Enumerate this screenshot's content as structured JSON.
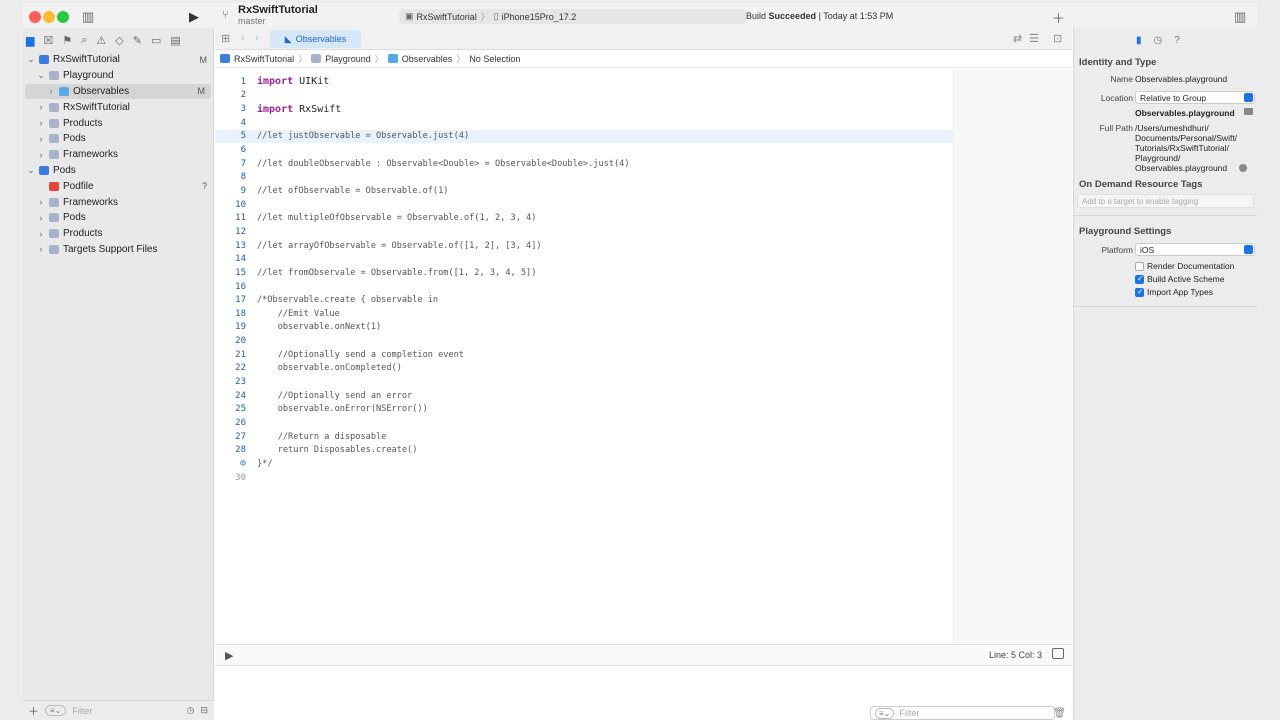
{
  "titlebar": {
    "project_name": "RxSwiftTutorial",
    "branch": "master",
    "scheme": "RxSwiftTutorial",
    "destination": "iPhone15Pro_17.2",
    "build_prefix": "Build",
    "build_status": "Succeeded",
    "build_time": "| Today at 1:53 PM"
  },
  "navigator": {
    "items": [
      {
        "label": "RxSwiftTutorial",
        "badge": "M"
      },
      {
        "label": "Playground",
        "badge": ""
      },
      {
        "label": "Observables",
        "badge": "M"
      },
      {
        "label": "RxSwiftTutorial",
        "badge": ""
      },
      {
        "label": "Products",
        "badge": ""
      },
      {
        "label": "Pods",
        "badge": ""
      },
      {
        "label": "Frameworks",
        "badge": ""
      },
      {
        "label": "Pods",
        "badge": ""
      },
      {
        "label": "Podfile",
        "badge": "?"
      },
      {
        "label": "Frameworks",
        "badge": ""
      },
      {
        "label": "Pods",
        "badge": ""
      },
      {
        "label": "Products",
        "badge": ""
      },
      {
        "label": "Targets Support Files",
        "badge": ""
      }
    ],
    "filter_placeholder": "Filter"
  },
  "editor": {
    "tab_label": "Observables",
    "breadcrumb": [
      "RxSwiftTutorial",
      "Playground",
      "Observables",
      "No Selection"
    ],
    "lines": [
      {
        "n": "1",
        "text": "import UIKit"
      },
      {
        "n": "2",
        "text": ""
      },
      {
        "n": "3",
        "text": "import RxSwift"
      },
      {
        "n": "4",
        "text": ""
      },
      {
        "n": "5",
        "text": "//let justObservable = Observable.just(4)"
      },
      {
        "n": "6",
        "text": ""
      },
      {
        "n": "7",
        "text": "//let doubleObservable : Observable<Double> = Observable<Double>.just(4)"
      },
      {
        "n": "8",
        "text": ""
      },
      {
        "n": "9",
        "text": "//let ofObservable = Observable.of(1)"
      },
      {
        "n": "10",
        "text": ""
      },
      {
        "n": "11",
        "text": "//let multipleOfObservable = Observable.of(1, 2, 3, 4)"
      },
      {
        "n": "12",
        "text": ""
      },
      {
        "n": "13",
        "text": "//let arrayOfObservable = Observable.of([1, 2], [3, 4])"
      },
      {
        "n": "14",
        "text": ""
      },
      {
        "n": "15",
        "text": "//let fromObservale = Observable.from([1, 2, 3, 4, 5])"
      },
      {
        "n": "16",
        "text": ""
      },
      {
        "n": "17",
        "text": "/*Observable.create { observable in"
      },
      {
        "n": "18",
        "text": "    //Emit Value"
      },
      {
        "n": "19",
        "text": "    observable.onNext(1)"
      },
      {
        "n": "20",
        "text": ""
      },
      {
        "n": "21",
        "text": "    //Optionally send a completion event"
      },
      {
        "n": "22",
        "text": "    observable.onCompleted()"
      },
      {
        "n": "23",
        "text": ""
      },
      {
        "n": "24",
        "text": "    //Optionally send an error"
      },
      {
        "n": "25",
        "text": "    observable.onError(NSError())"
      },
      {
        "n": "26",
        "text": ""
      },
      {
        "n": "27",
        "text": "    //Return a disposable"
      },
      {
        "n": "28",
        "text": "    return Disposables.create()"
      },
      {
        "n": "29",
        "text": "}*/"
      },
      {
        "n": "30",
        "text": ""
      }
    ],
    "cursor_position": "Line: 5  Col: 3",
    "console_filter_placeholder": "Filter"
  },
  "inspector": {
    "identity_title": "Identity and Type",
    "name_label": "Name",
    "name_value": "Observables.playground",
    "location_label": "Location",
    "location_value": "Relative to Group",
    "location_file": "Observables.playground",
    "fullpath_label": "Full Path",
    "fullpath_value": "/Users/umeshdhuri/ Documents/Personal/Swift/ Tutorials/RxSwiftTutorial/ Playground/ Observables.playground",
    "odr_title": "On Demand Resource Tags",
    "odr_placeholder": "Add to a target to enable tagging",
    "playground_title": "Playground Settings",
    "platform_label": "Platform",
    "platform_value": "iOS",
    "options": [
      {
        "label": "Render Documentation",
        "checked": false
      },
      {
        "label": "Build Active Scheme",
        "checked": true
      },
      {
        "label": "Import App Types",
        "checked": true
      }
    ]
  },
  "colors": {
    "accent": "#1a73e8",
    "keyword": "#9b2393",
    "line_number": "#1c5bb0",
    "current_line": "#e9f2fc"
  }
}
